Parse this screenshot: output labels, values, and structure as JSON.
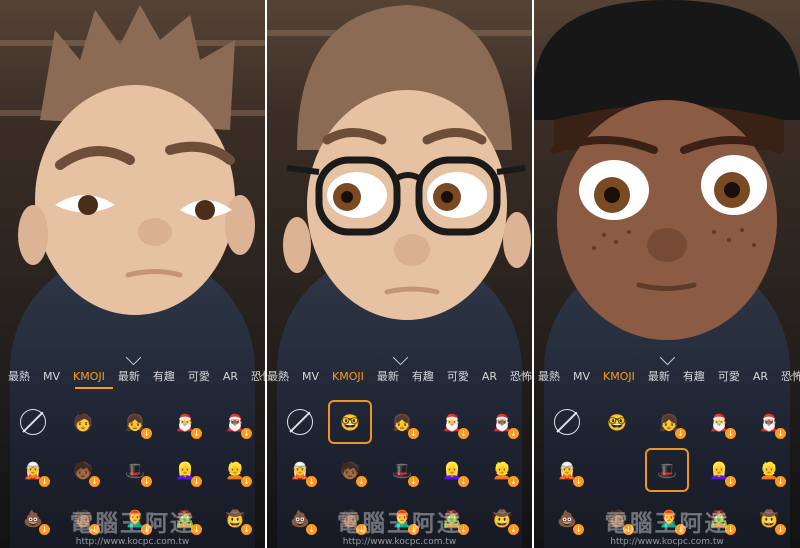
{
  "tabs": [
    "最熱",
    "MV",
    "KMOJI",
    "最新",
    "有趣",
    "可愛",
    "AR",
    "恐怖"
  ],
  "active_tab_index": 2,
  "panels": [
    {
      "name": "panel-left",
      "selected_cell": 0
    },
    {
      "name": "panel-middle",
      "selected_cell": 1
    },
    {
      "name": "panel-right",
      "selected_cell": 6
    }
  ],
  "watermark": {
    "text": "電腦王阿達",
    "url": "http://www.kocpc.com.tw"
  },
  "colors": {
    "accent": "#ff9a1e",
    "skin_light": "#e6c2a2",
    "skin_dark": "#8b5b43",
    "hair": "#8b6b53"
  },
  "stickers": [
    "none-icon",
    "boy-icon",
    "pink-hair-girl-icon",
    "santa-icon",
    "dark-santa-icon",
    "green-hair-icon",
    "red-hat-icon",
    "black-hat-icon",
    "white-hair-girl-icon",
    "blonde-girl-icon",
    "poop-icon",
    "red-hat-face-icon",
    "red-hair-icon",
    "green-hair-face-icon",
    "white-hat-icon"
  ]
}
